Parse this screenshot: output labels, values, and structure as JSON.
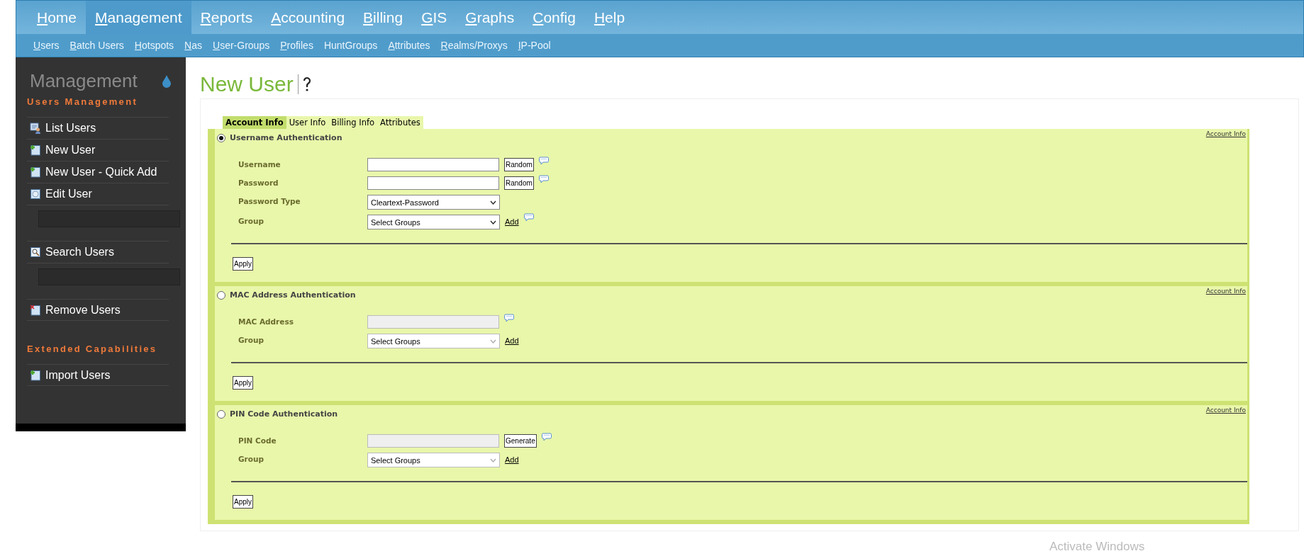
{
  "main_menu": [
    {
      "label": "Home",
      "hotkey_underlined": true,
      "selected": false
    },
    {
      "label": "Management",
      "hotkey_underlined": true,
      "selected": true
    },
    {
      "label": "Reports",
      "hotkey_underlined": true,
      "selected": false
    },
    {
      "label": "Accounting",
      "hotkey_underlined": true,
      "selected": false
    },
    {
      "label": "Billing",
      "hotkey_underlined": true,
      "selected": false
    },
    {
      "label": "GIS",
      "hotkey_underlined": true,
      "selected": false
    },
    {
      "label": "Graphs",
      "hotkey_underlined": true,
      "selected": false
    },
    {
      "label": "Config",
      "hotkey_underlined": true,
      "selected": false
    },
    {
      "label": "Help",
      "hotkey_underlined": true,
      "selected": false
    }
  ],
  "sub_menu": [
    {
      "label": "Users",
      "hotkey_underlined": true
    },
    {
      "label": "Batch Users",
      "hotkey_underlined": true
    },
    {
      "label": "Hotspots",
      "hotkey_underlined": true
    },
    {
      "label": "Nas",
      "hotkey_underlined": true
    },
    {
      "label": "User-Groups",
      "hotkey_underlined": true
    },
    {
      "label": "Profiles",
      "hotkey_underlined": true
    },
    {
      "label": "HuntGroups",
      "hotkey_underlined": false
    },
    {
      "label": "Attributes",
      "hotkey_underlined": true
    },
    {
      "label": "Realms/Proxys",
      "hotkey_underlined": true
    },
    {
      "label": "IP-Pool",
      "hotkey_underlined": true
    }
  ],
  "sidebar": {
    "title": "Management",
    "sections": [
      {
        "heading": "Users Management",
        "items": [
          {
            "label": "List Users",
            "kind": "list"
          },
          {
            "label": "New User",
            "kind": "add"
          },
          {
            "label": "New User - Quick Add",
            "kind": "add"
          },
          {
            "label": "Edit User",
            "kind": "edit"
          },
          {
            "label": "Search Users",
            "kind": "search"
          },
          {
            "label": "Remove Users",
            "kind": "remove"
          }
        ]
      },
      {
        "heading": "Extended Capabilities",
        "items": [
          {
            "label": "Import Users",
            "kind": "add"
          }
        ]
      }
    ]
  },
  "page_title": "New User",
  "tabs": [
    {
      "label": "Account Info",
      "selected": true
    },
    {
      "label": "User Info",
      "selected": false
    },
    {
      "label": "Billing Info",
      "selected": false
    },
    {
      "label": "Attributes",
      "selected": false
    }
  ],
  "sections": [
    {
      "title": "Username Authentication",
      "selected": true,
      "corner_link": "Account Info",
      "apply": "Apply",
      "fields": [
        {
          "label": "Username",
          "kind": "text",
          "disabled": false,
          "button": "Random",
          "tip": true
        },
        {
          "label": "Password",
          "kind": "text",
          "disabled": false,
          "button": "Random",
          "tip": true
        },
        {
          "label": "Password Type",
          "kind": "select",
          "disabled": false,
          "value": "Cleartext-Password",
          "tip": false
        },
        {
          "label": "Group",
          "kind": "select",
          "disabled": false,
          "value": "Select Groups",
          "link": "Add",
          "tip": true
        }
      ]
    },
    {
      "title": "MAC Address Authentication",
      "selected": false,
      "corner_link": "Account Info",
      "apply": "Apply",
      "fields": [
        {
          "label": "MAC Address",
          "kind": "text",
          "disabled": true,
          "tip": true
        },
        {
          "label": "Group",
          "kind": "select",
          "disabled": true,
          "value": "Select Groups",
          "link": "Add",
          "tip": false
        }
      ]
    },
    {
      "title": "PIN Code Authentication",
      "selected": false,
      "corner_link": "Account Info",
      "apply": "Apply",
      "fields": [
        {
          "label": "PIN Code",
          "kind": "text",
          "disabled": true,
          "button": "Generate",
          "tip": true
        },
        {
          "label": "Group",
          "kind": "select",
          "disabled": true,
          "value": "Select Groups",
          "link": "Add",
          "tip": false
        }
      ]
    }
  ],
  "os_notice": "Activate Windows"
}
